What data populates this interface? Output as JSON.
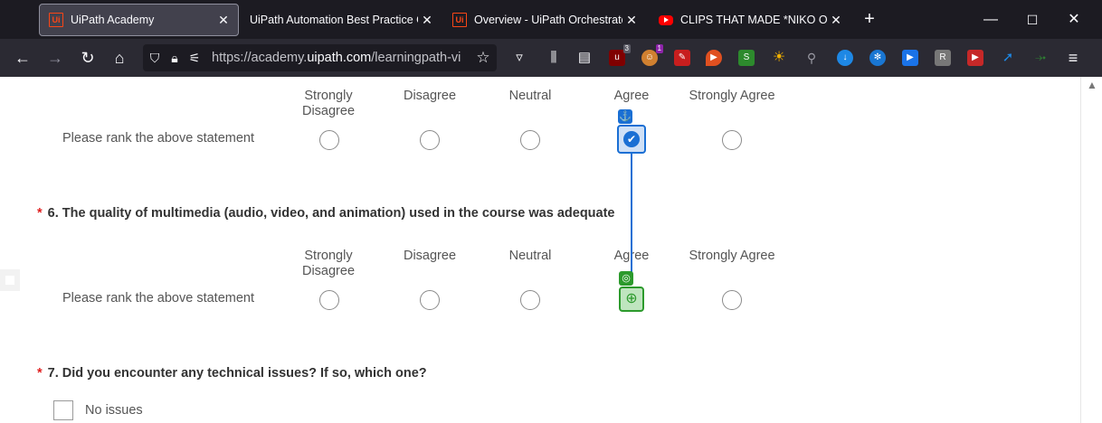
{
  "browser": {
    "tabs": [
      {
        "title": "UiPath Academy",
        "icon": "uipath-icon",
        "active": true
      },
      {
        "title": "UiPath Automation Best Practice Gu",
        "icon": "none",
        "active": false
      },
      {
        "title": "Overview - UiPath Orchestrator",
        "icon": "uipath-icon",
        "active": false
      },
      {
        "title": "CLIPS THAT MADE *NIKO OMIL",
        "icon": "youtube-icon",
        "active": false
      }
    ],
    "new_tab_symbol": "+",
    "window_controls": {
      "minimize": "—",
      "maximize": "☐",
      "close": "✕"
    },
    "url": {
      "prefix": "https://academy.",
      "domain": "uipath.com",
      "path": "/learningpath-vi"
    },
    "extensions": [
      {
        "name": "ublock-icon",
        "color": "#800000",
        "badge": "3"
      },
      {
        "name": "avatar-ext-icon",
        "color": "#d08030",
        "badge": "1"
      },
      {
        "name": "red-ext-icon",
        "color": "#c81e1e"
      },
      {
        "name": "brave-ext-icon",
        "color": "#e05020"
      },
      {
        "name": "green-ext-icon",
        "color": "#2d8a2d"
      },
      {
        "name": "sun-ext-icon",
        "color": "#f0b000"
      },
      {
        "name": "magnifier-ext-icon",
        "color": "#555555"
      },
      {
        "name": "download-ext-icon",
        "color": "#1e88e5"
      },
      {
        "name": "gear-ext-icon",
        "color": "#1976d2"
      },
      {
        "name": "clapper-ext-icon",
        "color": "#1a73e8"
      },
      {
        "name": "grey-ext-icon",
        "color": "#777777"
      },
      {
        "name": "red2-ext-icon",
        "color": "#c62828"
      },
      {
        "name": "arrow-ext-icon",
        "color": "#1565c0"
      },
      {
        "name": "leaf-ext-icon",
        "color": "#2e7d32"
      }
    ]
  },
  "survey": {
    "scale": [
      "Strongly\nDisagree",
      "Disagree",
      "Neutral",
      "Agree",
      "Strongly Agree"
    ],
    "row_label": "Please rank the above statement",
    "q5_selected": "Agree",
    "question6": {
      "required_mark": "*",
      "text": "6. The quality of multimedia (audio, video, and animation) used in the course was adequate"
    },
    "question7": {
      "required_mark": "*",
      "text": "7. Did you encounter any technical issues? If so, which one?"
    },
    "option_no_issues": "No issues"
  }
}
